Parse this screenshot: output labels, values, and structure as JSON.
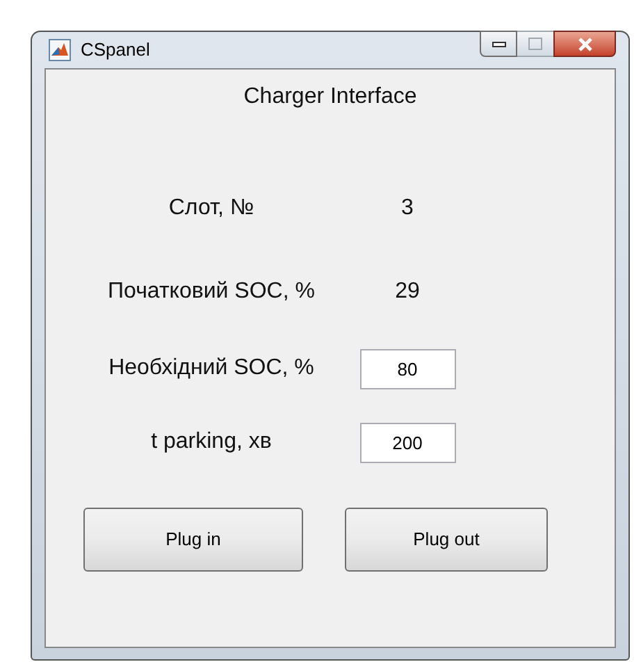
{
  "window": {
    "title": "CSpanel"
  },
  "heading": "Charger Interface",
  "rows": [
    {
      "kind": "value",
      "label": "Слот, №",
      "value": "3"
    },
    {
      "kind": "value",
      "label": "Початковий SOC, %",
      "value": "29"
    },
    {
      "kind": "field",
      "label": "Необхідний SOC, %",
      "value": "80"
    },
    {
      "kind": "field",
      "label": "t parking, хв",
      "value": "200"
    }
  ],
  "buttons": [
    "Plug in",
    "Plug out"
  ]
}
